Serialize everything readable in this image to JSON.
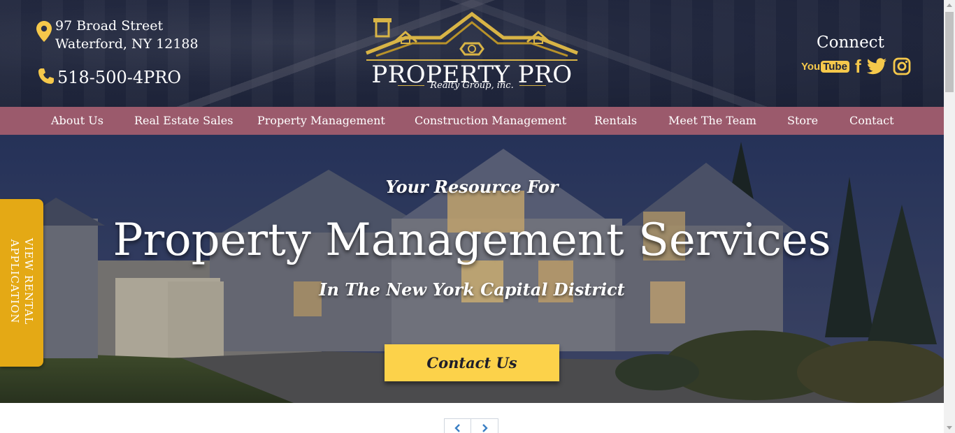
{
  "header": {
    "address_line1": "97 Broad Street",
    "address_line2": "Waterford, NY 12188",
    "phone": "518-500-4PRO",
    "logo_name": "PROPERTY PRO",
    "logo_sub": "Realty Group, inc.",
    "connect_label": "Connect",
    "social": {
      "youtube_you": "You",
      "youtube_tube": "Tube",
      "facebook_glyph": "f",
      "icons": [
        "youtube-icon",
        "facebook-icon",
        "twitter-icon",
        "instagram-icon"
      ]
    }
  },
  "nav": {
    "items": [
      "About Us",
      "Real Estate Sales",
      "Property Management",
      "Construction Management",
      "Rentals",
      "Meet The Team",
      "Store",
      "Contact"
    ]
  },
  "hero": {
    "kicker": "Your Resource For",
    "title": "Property Management Services",
    "subtitle": "In The New York Capital District",
    "cta": "Contact Us"
  },
  "side_tab": {
    "label_line1": "VIEW RENTAL",
    "label_line2": "APPLICATION"
  },
  "colors": {
    "nav_bg": "#9b5a6c",
    "accent_gold": "#fcd24a",
    "side_tab": "#e4a915",
    "icon_gold": "#f5c84b"
  }
}
